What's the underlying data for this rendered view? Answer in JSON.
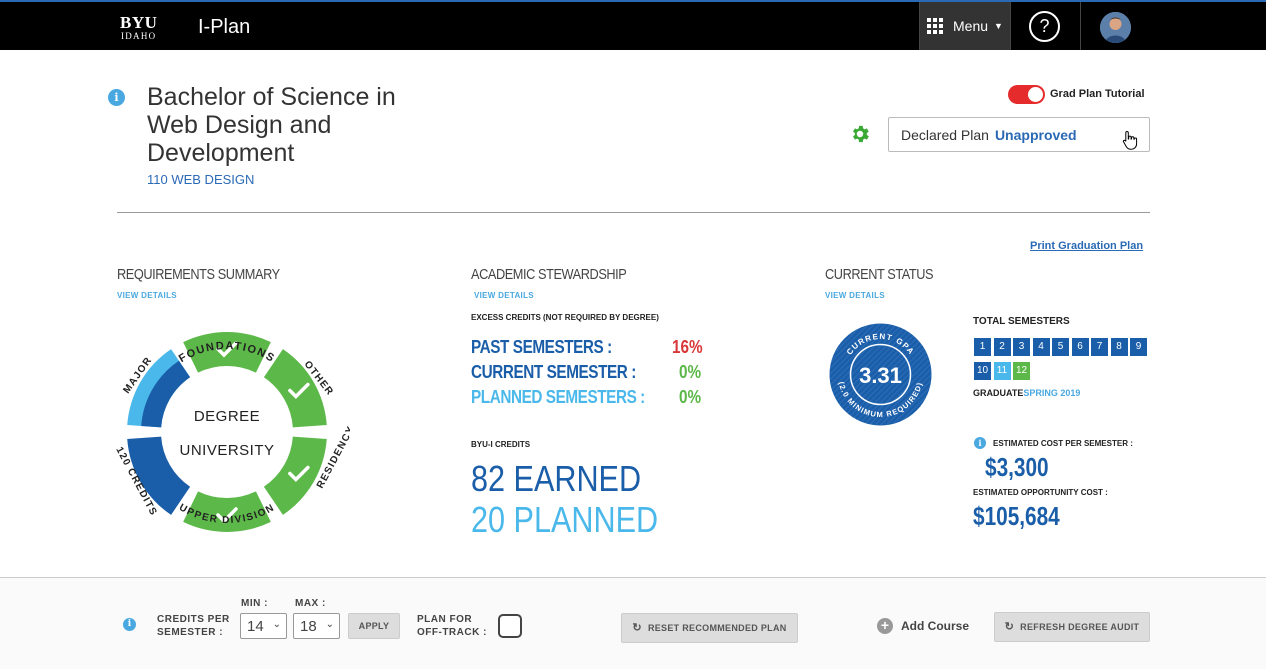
{
  "topbar": {
    "logo_line1": "BYU",
    "logo_line2": "IDAHO",
    "app_title": "I-Plan",
    "menu_label": "Menu",
    "help_label": "?"
  },
  "header": {
    "info_icon": "i",
    "degree_title": "Bachelor of Science in Web Design and Development",
    "degree_code": "110 WEB DESIGN",
    "tutorial_label": "Grad Plan Tutorial",
    "tutorial_on": true,
    "plan_label": "Declared Plan",
    "plan_status": "Unapproved",
    "print_link": "Print Graduation Plan"
  },
  "requirements": {
    "title": "REQUIREMENTS SUMMARY",
    "view_details": "VIEW DETAILS",
    "center_line1": "DEGREE",
    "center_line2": "UNIVERSITY",
    "labels": {
      "foundations": "FOUNDATIONS",
      "other": "OTHER",
      "residency": "RESIDENCY",
      "upper_division": "UPPER DIVISION",
      "credits_120": "120 CREDITS",
      "major": "MAJOR"
    }
  },
  "stewardship": {
    "title": "ACADEMIC STEWARDSHIP",
    "view_details": "VIEW DETAILS",
    "excess_label": "EXCESS CREDITS (NOT REQUIRED BY DEGREE)",
    "rows": [
      {
        "label": "PAST SEMESTERS :",
        "value": "16%"
      },
      {
        "label": "CURRENT SEMESTER :",
        "value": "0%"
      },
      {
        "label": "PLANNED SEMESTERS :",
        "value": "0%"
      }
    ],
    "credits_label": "BYU-I CREDITS",
    "earned": "82 EARNED",
    "planned": "20 PLANNED"
  },
  "status": {
    "title": "CURRENT STATUS",
    "view_details": "VIEW DETAILS",
    "gpa_top": "CURRENT GPA",
    "gpa_value": "3.31",
    "gpa_bottom": "(2.0 MINIMUM REQUIRED)",
    "total_semesters_label": "TOTAL SEMESTERS",
    "semesters": [
      "1",
      "2",
      "3",
      "4",
      "5",
      "6",
      "7",
      "8",
      "9",
      "10",
      "11",
      "12"
    ],
    "graduate_label": "GRADUATE",
    "graduate_value": "SPRING 2019",
    "cost_sem_label": "ESTIMATED COST PER SEMESTER :",
    "cost_sem_value": "$3,300",
    "cost_opp_label": "ESTIMATED OPPORTUNITY COST :",
    "cost_opp_value": "$105,684"
  },
  "bottombar": {
    "credits_label_1": "CREDITS PER",
    "credits_label_2": "SEMESTER :",
    "min_label": "MIN :",
    "min_value": "14",
    "max_label": "MAX :",
    "max_value": "18",
    "apply_label": "APPLY",
    "offtrack_1": "PLAN FOR",
    "offtrack_2": "OFF-TRACK :",
    "reset_label": "RESET RECOMMENDED PLAN",
    "add_course_label": "Add Course",
    "refresh_label": "REFRESH DEGREE AUDIT"
  },
  "colors": {
    "accent_blue": "#1a5da8",
    "light_blue": "#4ab8ea",
    "green": "#5cb848",
    "red": "#d8383a"
  }
}
